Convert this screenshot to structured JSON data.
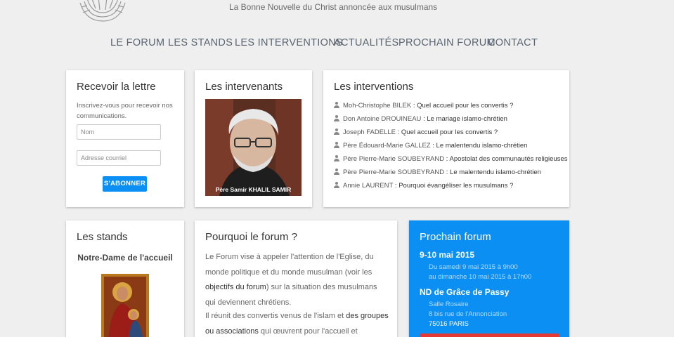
{
  "header": {
    "tagline": "La Bonne Nouvelle du Christ annoncée aux musulmans"
  },
  "nav": [
    {
      "label": "LE FORUM"
    },
    {
      "label": "LES STANDS"
    },
    {
      "label": "LES INTERVENTIONS"
    },
    {
      "label": "ACTUALITÉS"
    },
    {
      "label": "PROCHAIN FORUM"
    },
    {
      "label": "CONTACT"
    }
  ],
  "newsletter": {
    "title": "Recevoir la lettre",
    "intro": "Inscrivez-vous pour recevoir nos communications.",
    "name_placeholder": "Nom",
    "email_placeholder": "Adresse courriel",
    "subscribe_label": "S'ABONNER"
  },
  "speakers": {
    "title": "Les intervenants",
    "photo_caption": "Père Samir KHALIL SAMIR"
  },
  "interventions": {
    "title": "Les interventions",
    "items": [
      {
        "speaker": "Moh-Christophe BILEK",
        "topic": ": Quel accueil pour les convertis ?"
      },
      {
        "speaker": "Don Antoine DROUINEAU",
        "topic": ": Le mariage islamo-chrétien"
      },
      {
        "speaker": "Joseph FADELLE",
        "topic": ": Quel accueil pour les convertis ?"
      },
      {
        "speaker": "Père Édouard-Marie GALLEZ",
        "topic": ": Le malentendu islamo-chrétien"
      },
      {
        "speaker": "Père Pierre-Marie SOUBEYRAND",
        "topic": ": Apostolat des communautés religieuses"
      },
      {
        "speaker": "Père Pierre-Marie SOUBEYRAND",
        "topic": ": Le malentendu islamo-chrétien"
      },
      {
        "speaker": "Annie LAURENT",
        "topic": ": Pourquoi évangéliser les musulmans ?"
      }
    ]
  },
  "stands": {
    "title": "Les stands",
    "subtitle": "Notre-Dame de l'accueil"
  },
  "why": {
    "title": "Pourquoi le forum ?",
    "p1_a": "Le Forum vise à appeler l'attention de l'Eglise, du monde politique et du monde musulman (voir les ",
    "p1_link": "objectifs du forum",
    "p1_b": ") sur la situation des musulmans qui deviennent chrétiens.",
    "p2_a": "Il réunit des convertis venus de l'islam et ",
    "p2_link": "des groupes ou associations",
    "p2_b": " qui œuvrent pour l'accueil et"
  },
  "next_forum": {
    "title": "Prochain forum",
    "dates": "9-10 mai 2015",
    "line1": "Du samedi 9 mai 2015 à 9h00",
    "line2": "au dimanche 10 mai 2015 à 17h00",
    "venue": "ND de Grâce de Passy",
    "hall": "Salle Rosaire",
    "street": "8 bis rue de l'Annonciation",
    "city": "75016 PARIS"
  },
  "colors": {
    "accent": "#0c8ff2",
    "background": "#efefef"
  }
}
